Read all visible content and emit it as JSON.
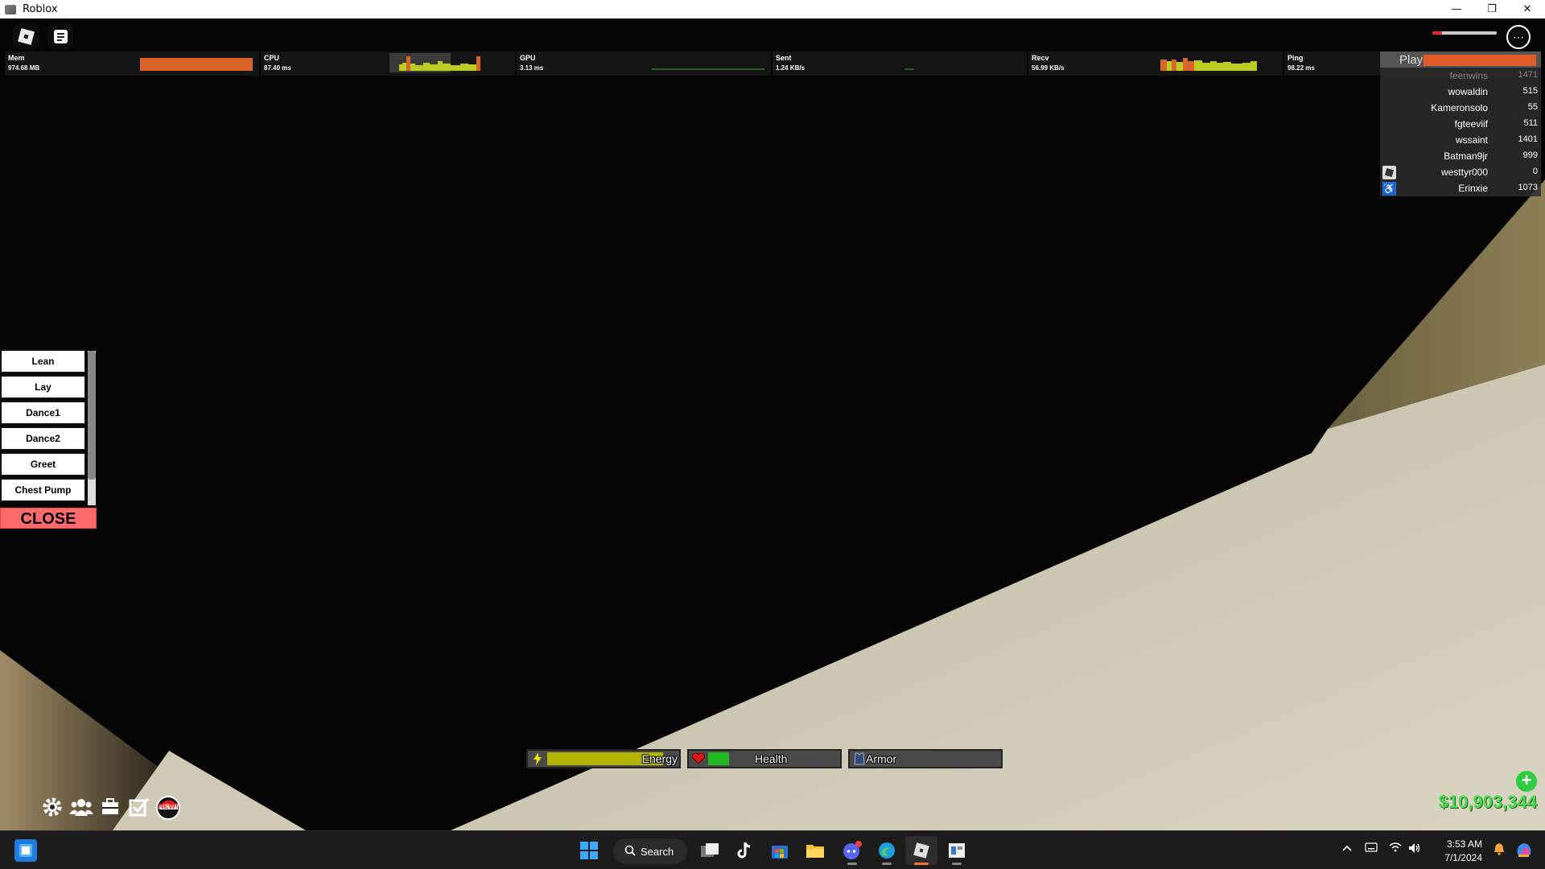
{
  "window": {
    "title": "Roblox",
    "minimize_glyph": "—",
    "restore_glyph": "❐",
    "close_glyph": "✕"
  },
  "perf": [
    {
      "label": "Mem",
      "value": "974.68 MB"
    },
    {
      "label": "CPU",
      "value": "87.40 ms"
    },
    {
      "label": "GPU",
      "value": "3.13 ms"
    },
    {
      "label": "Sent",
      "value": "1.24 KB/s"
    },
    {
      "label": "Recv",
      "value": "56.99 KB/s"
    },
    {
      "label": "Ping",
      "value": "98.22 ms"
    }
  ],
  "playerlist": {
    "title": "Play",
    "players": [
      {
        "name": "feenwins",
        "value": "1471",
        "badge": ""
      },
      {
        "name": "wowaldin",
        "value": "515",
        "badge": ""
      },
      {
        "name": "Kameronsolo",
        "value": "55",
        "badge": ""
      },
      {
        "name": "fgteeviif",
        "value": "511",
        "badge": ""
      },
      {
        "name": "wssaint",
        "value": "1401",
        "badge": ""
      },
      {
        "name": "Batman9jr",
        "value": "999",
        "badge": ""
      },
      {
        "name": "westtyr000",
        "value": "0",
        "badge": "roblox-icon"
      },
      {
        "name": "Erinxie",
        "value": "1073",
        "badge": "accessibility-icon"
      }
    ]
  },
  "emotes": {
    "items": [
      "Lean",
      "Lay",
      "Dance1",
      "Dance2",
      "Greet",
      "Chest Pump"
    ],
    "close_label": "CLOSE"
  },
  "stats": {
    "energy": {
      "label": "Energy",
      "level": 0.88,
      "color": "#b3b300"
    },
    "health": {
      "label": "Health",
      "level": 0.16,
      "color": "#22b822"
    },
    "armor": {
      "label": "Armor",
      "level": 0.0,
      "color": "#555555"
    }
  },
  "hud": {
    "new_badge": "NEW!",
    "icons": [
      "gear-icon",
      "friends-icon",
      "inventory-icon",
      "check-icon",
      "santa-hat-icon"
    ]
  },
  "cash": {
    "amount": "$10,903,344",
    "plus": "+"
  },
  "taskbar": {
    "search_label": "Search",
    "time": "3:53 AM",
    "date": "7/1/2024",
    "apps": [
      "windows-start-icon",
      "task-view-icon",
      "tiktok-icon",
      "microsoft-store-icon",
      "file-explorer-icon",
      "discord-icon",
      "edge-icon",
      "roblox-icon",
      "roblox-studio-icon"
    ]
  }
}
